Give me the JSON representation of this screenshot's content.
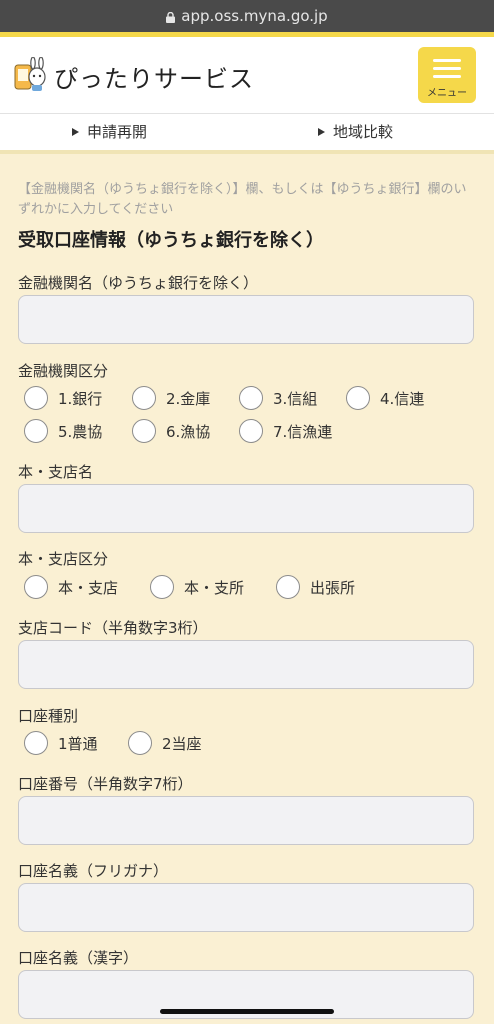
{
  "browser": {
    "url": "app.oss.myna.go.jp"
  },
  "header": {
    "brand": "ぴったりサービス",
    "menu_label": "メニュー"
  },
  "subnav": {
    "items": [
      {
        "label": "申請再開"
      },
      {
        "label": "地域比較"
      }
    ]
  },
  "form": {
    "note": "【金融機関名（ゆうちょ銀行を除く）】欄、もしくは【ゆうちょ銀行】欄のいずれかに入力してください",
    "section_title": "受取口座情報（ゆうちょ銀行を除く）",
    "bank_name": {
      "label": "金融機関名（ゆうちょ銀行を除く）",
      "value": "",
      "placeholder": ""
    },
    "bank_type": {
      "label": "金融機関区分",
      "options": [
        "1.銀行",
        "2.金庫",
        "3.信組",
        "4.信連",
        "5.農協",
        "6.漁協",
        "7.信漁連"
      ]
    },
    "branch_name": {
      "label": "本・支店名",
      "value": "",
      "placeholder": ""
    },
    "branch_type": {
      "label": "本・支店区分",
      "options": [
        "本・支店",
        "本・支所",
        "出張所"
      ]
    },
    "branch_code": {
      "label": "支店コード（半角数字3桁）",
      "value": "",
      "placeholder": ""
    },
    "account_type": {
      "label": "口座種別",
      "options": [
        "1普通",
        "2当座"
      ]
    },
    "account_number": {
      "label": "口座番号（半角数字7桁）",
      "value": "",
      "placeholder": ""
    },
    "account_holder_kana": {
      "label": "口座名義（フリガナ）",
      "value": "",
      "placeholder": ""
    },
    "account_holder_kanji": {
      "label": "口座名義（漢字）",
      "value": "",
      "placeholder": ""
    }
  },
  "colors": {
    "accent": "#f5d84a",
    "background": "#faf0d3",
    "field_bg": "#f2f2f4"
  },
  "icons": {
    "lock": "lock-icon",
    "logo": "mascot-logo-icon",
    "menu": "hamburger-icon"
  }
}
